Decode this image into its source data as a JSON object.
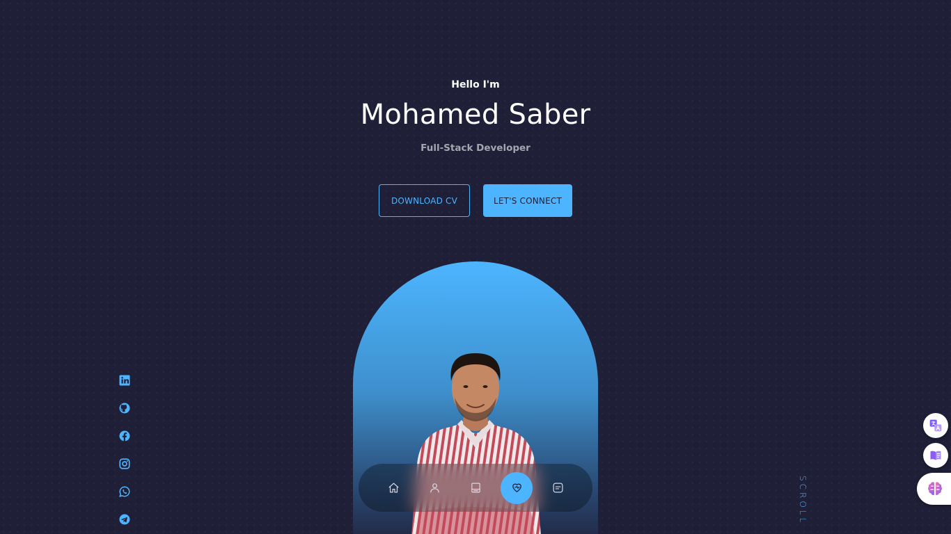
{
  "header": {
    "greeting": "Hello I'm",
    "name": "Mohamed Saber",
    "role": "Full-Stack Developer"
  },
  "cta": {
    "download_label": "DOWNLOAD CV",
    "connect_label": "LET'S CONNECT"
  },
  "socials": [
    "linkedin-icon",
    "github-icon",
    "facebook-icon",
    "instagram-icon",
    "whatsapp-icon",
    "telegram-icon"
  ],
  "scroll_label": "SCROLL",
  "nav": {
    "items": [
      "home-icon",
      "user-icon",
      "book-icon",
      "services-icon",
      "message-icon"
    ],
    "active": "services-icon"
  },
  "floating_tools": [
    "translate-icon",
    "reader-icon",
    "ai-brain-icon"
  ],
  "colors": {
    "background": "#1f1f38",
    "accent": "#4db5ff",
    "text": "#ffffff",
    "muted": "#9a9aae"
  }
}
